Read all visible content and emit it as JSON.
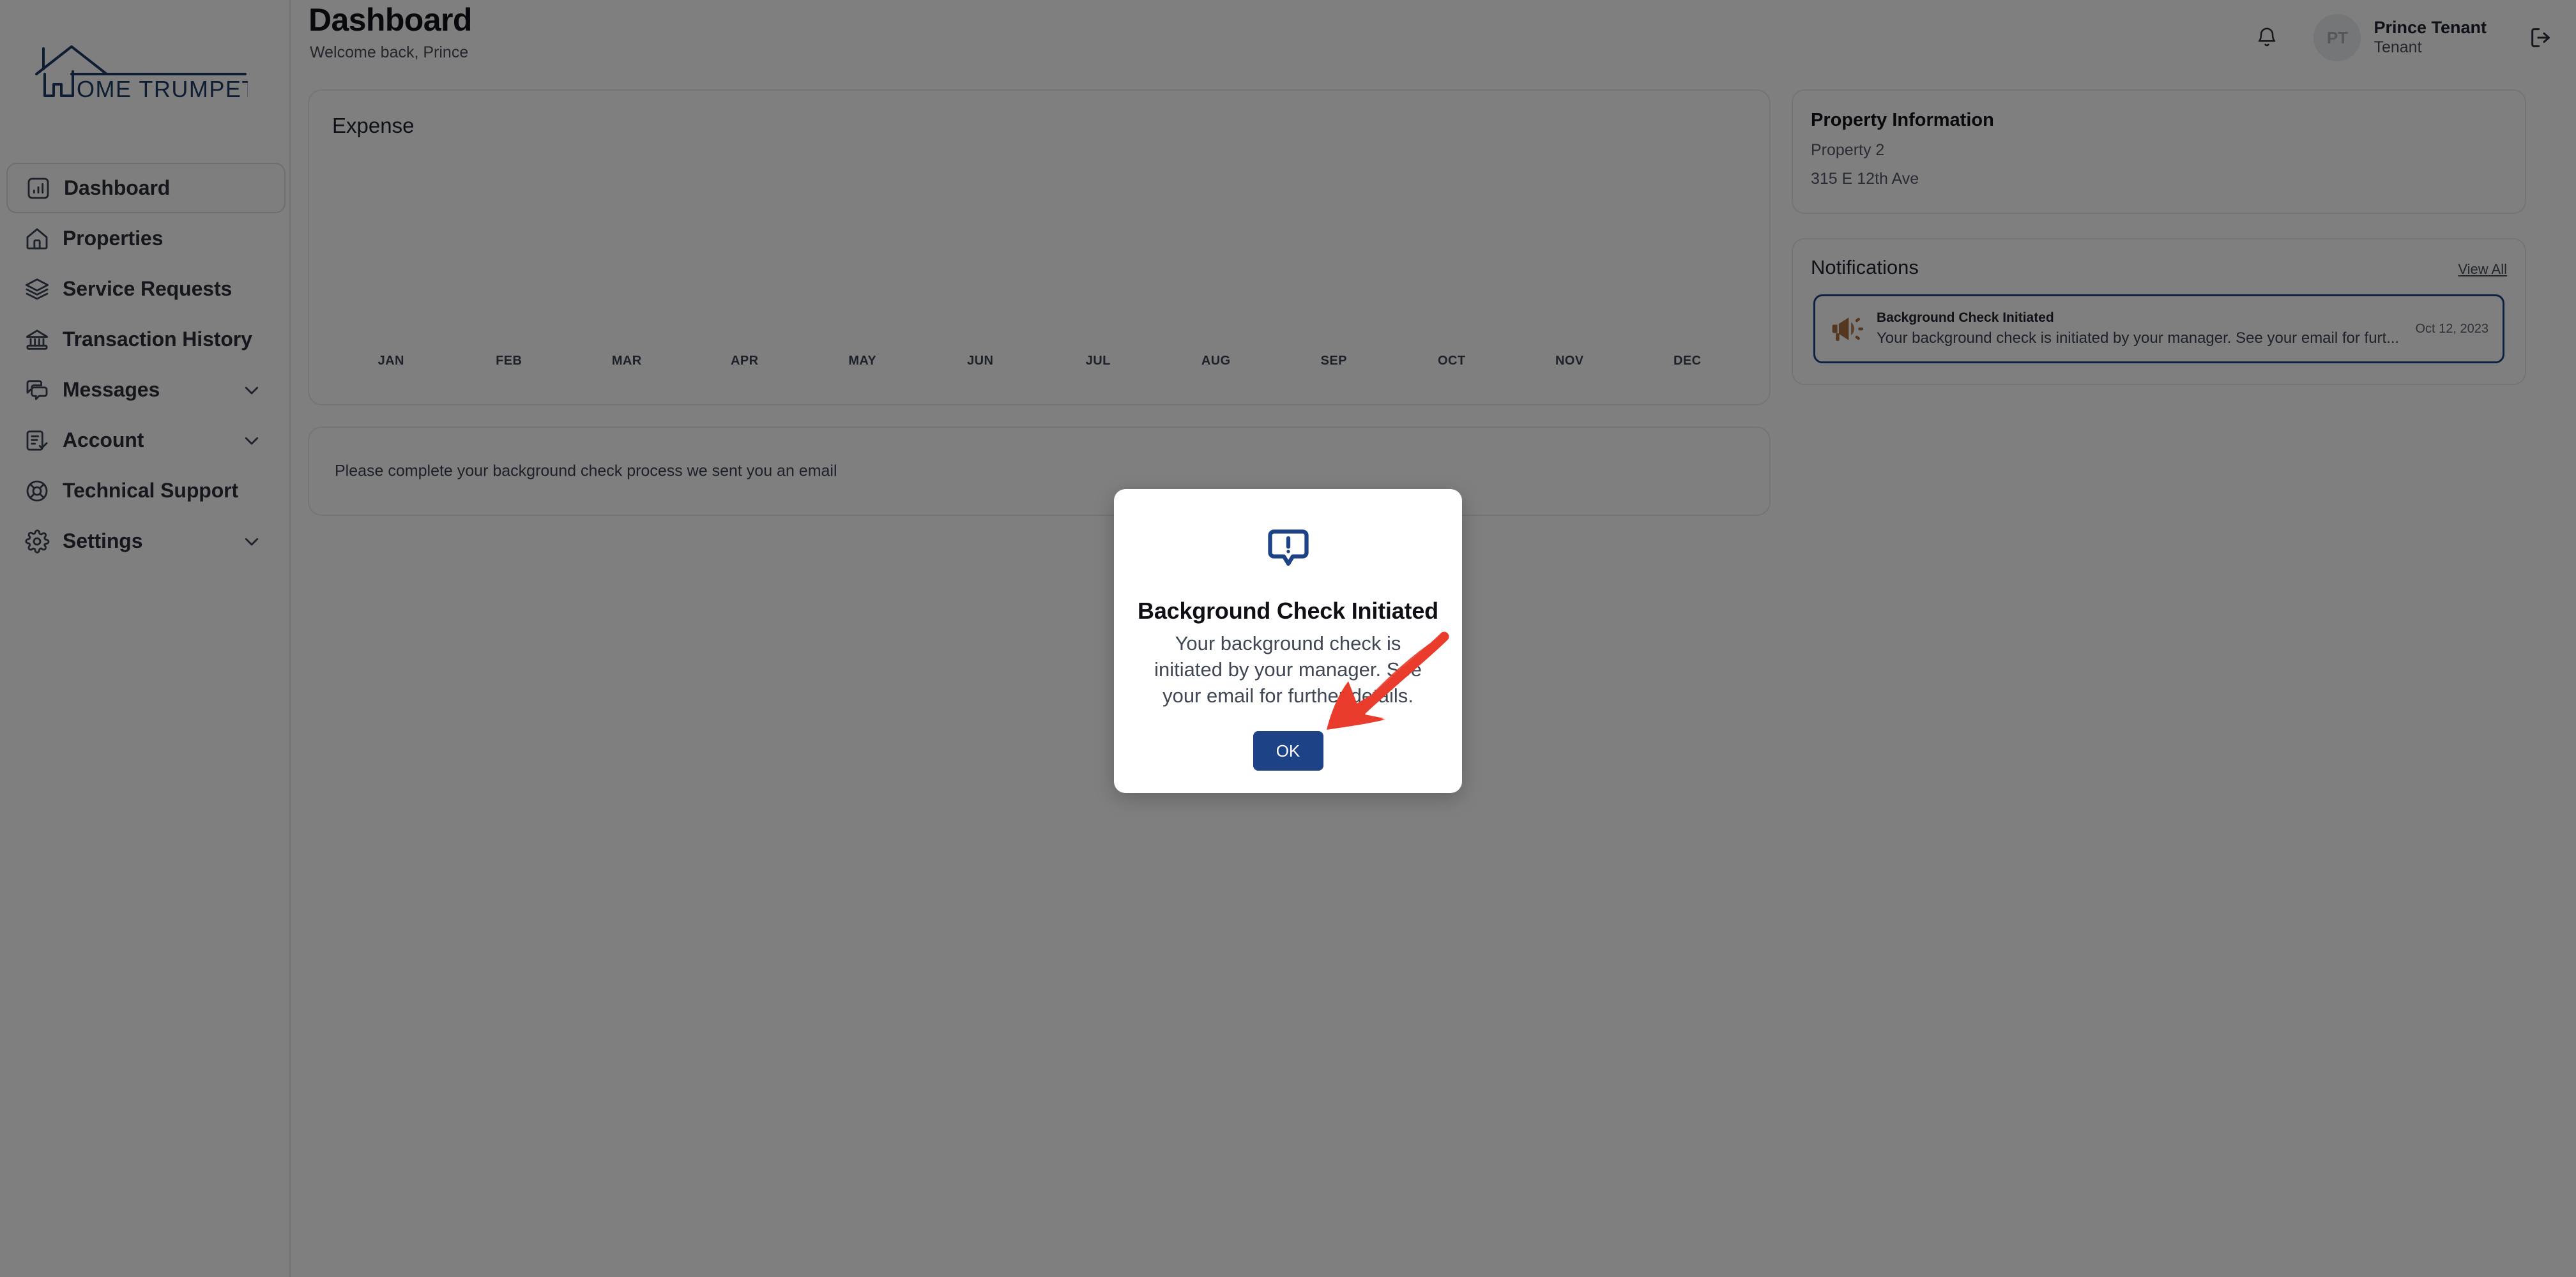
{
  "app": {
    "logo_text": "OME TRUMPETER",
    "logo_name": "Home Trumpeter",
    "brand_color": "#1e3a66"
  },
  "sidebar": {
    "items": [
      {
        "label": "Dashboard",
        "icon": "bar-chart-icon",
        "active": true,
        "expandable": false
      },
      {
        "label": "Properties",
        "icon": "home-icon",
        "active": false,
        "expandable": false
      },
      {
        "label": "Service Requests",
        "icon": "layers-icon",
        "active": false,
        "expandable": false
      },
      {
        "label": "Transaction History",
        "icon": "bank-icon",
        "active": false,
        "expandable": false
      },
      {
        "label": "Messages",
        "icon": "chat-bubbles-icon",
        "active": false,
        "expandable": true
      },
      {
        "label": "Account",
        "icon": "document-check-icon",
        "active": false,
        "expandable": true
      },
      {
        "label": "Technical Support",
        "icon": "lifebuoy-icon",
        "active": false,
        "expandable": false
      },
      {
        "label": "Settings",
        "icon": "gear-icon",
        "active": false,
        "expandable": true
      }
    ]
  },
  "header": {
    "title": "Dashboard",
    "subtitle": "Welcome back, Prince",
    "bell_icon": "bell-icon",
    "logout_icon": "logout-icon",
    "user": {
      "initials": "PT",
      "name": "Prince Tenant",
      "role": "Tenant"
    }
  },
  "main": {
    "expense": {
      "title": "Expense"
    },
    "notice": {
      "text": "Please complete your background check process we sent you an email"
    }
  },
  "chart_data": {
    "type": "bar",
    "title": "Expense",
    "categories": [
      "JAN",
      "FEB",
      "MAR",
      "APR",
      "MAY",
      "JUN",
      "JUL",
      "AUG",
      "SEP",
      "OCT",
      "NOV",
      "DEC"
    ],
    "values": [
      0,
      0,
      0,
      0,
      0,
      0,
      0,
      0,
      0,
      0,
      0,
      0
    ],
    "xlabel": "",
    "ylabel": "",
    "ylim": [
      0,
      0
    ],
    "grid": false,
    "legend": "none",
    "note": "Chart canvas is empty - only month tick labels are rendered"
  },
  "right_panel": {
    "property": {
      "title": "Property Information",
      "name": "Property 2",
      "address": "315 E 12th Ave"
    },
    "notifications": {
      "title": "Notifications",
      "view_all": "View All",
      "items": [
        {
          "icon": "megaphone-icon",
          "title": "Background Check Initiated",
          "desc": "Your background check is initiated by your manager. See your email for furt...",
          "date": "Oct 12, 2023",
          "highlight_color": "#1e4286"
        }
      ]
    }
  },
  "modal": {
    "icon": "alert-speech-bubble-icon",
    "title": "Background Check Initiated",
    "message": "Your background check is initiated by your manager. See your email for further details.",
    "ok_label": "OK",
    "accent_color": "#1e4286"
  },
  "annotation": {
    "arrow_color": "#ea3c2d",
    "points_to": "OK"
  }
}
